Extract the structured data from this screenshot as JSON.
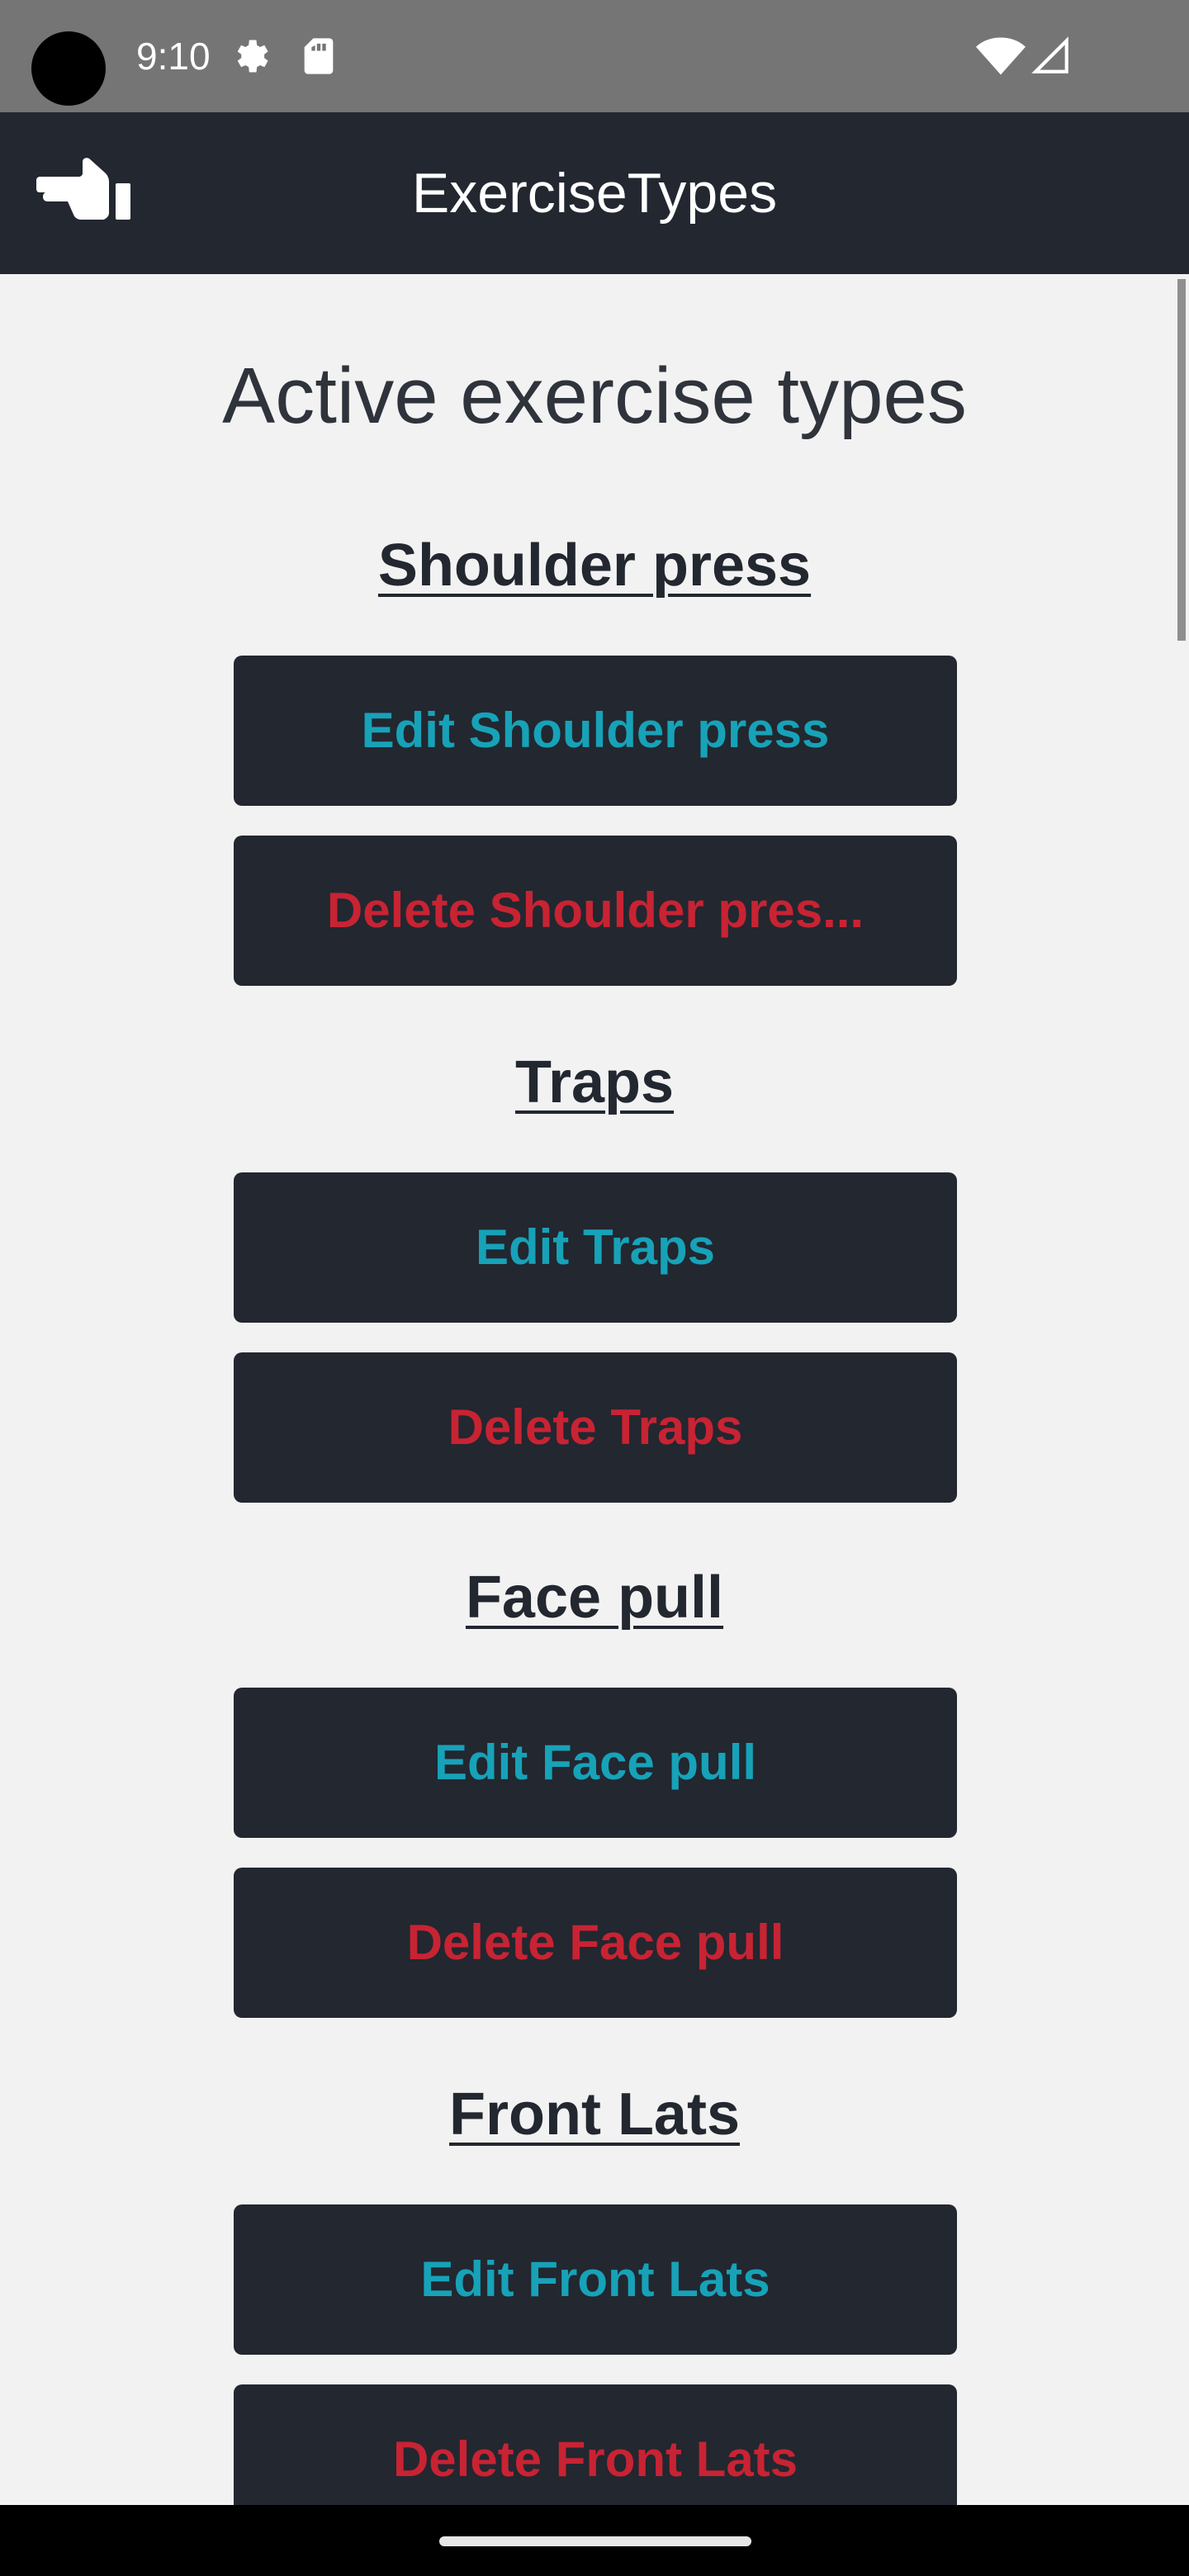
{
  "status_bar": {
    "time": "9:10",
    "icons": [
      "gear-icon",
      "sd-card-icon",
      "wifi-icon",
      "signal-icon"
    ]
  },
  "app_bar": {
    "title": "ExerciseTypes",
    "icon": "pointing-hand-icon"
  },
  "main": {
    "heading": "Active exercise types",
    "exercises": [
      {
        "name": "Shoulder press",
        "edit_label": "Edit Shoulder press",
        "delete_label": "Delete Shoulder pres..."
      },
      {
        "name": "Traps",
        "edit_label": "Edit Traps",
        "delete_label": "Delete Traps"
      },
      {
        "name": "Face pull",
        "edit_label": "Edit Face pull",
        "delete_label": "Delete Face pull"
      },
      {
        "name": "Front Lats",
        "edit_label": "Edit Front Lats",
        "delete_label": "Delete Front Lats"
      }
    ]
  },
  "colors": {
    "app_bar": "#222730",
    "background": "#f2f2f2",
    "edit_text": "#17a2b8",
    "delete_text": "#c82333"
  }
}
